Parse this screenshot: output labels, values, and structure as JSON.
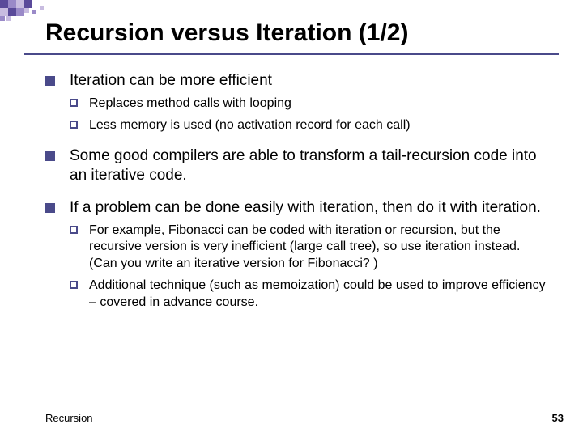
{
  "title": "Recursion versus Iteration (1/2)",
  "bullets": [
    {
      "text": "Iteration can be more efficient",
      "sub": [
        "Replaces method calls with looping",
        "Less memory is used (no activation record for each call)"
      ]
    },
    {
      "text": "Some good compilers are able to transform a tail-recursion code into an iterative code.",
      "sub": []
    },
    {
      "text": "If a problem can be done easily with iteration, then do it with iteration.",
      "sub": [
        "For example, Fibonacci can be coded with iteration or recursion, but the recursive version is very inefficient (large call tree), so use iteration instead. (Can you write an iterative version for Fibonacci? )",
        "Additional technique (such as memoization) could be used to improve efficiency – covered in advance course."
      ]
    }
  ],
  "footer_left": "Recursion",
  "footer_right": "53",
  "deco_colors": {
    "dark": "#5a4a9a",
    "mid": "#9a8ac8",
    "light": "#c8bce0"
  }
}
